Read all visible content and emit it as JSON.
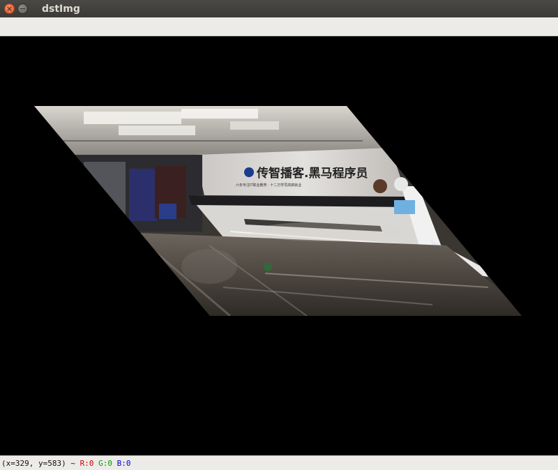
{
  "window": {
    "title": "dstImg",
    "close_glyph": "×",
    "minimize_glyph": "−"
  },
  "status": {
    "coords": "(x=329, y=583) ~",
    "r": "R:0",
    "g": "G:0",
    "b": "B:0"
  },
  "image": {
    "sign_main": "传智播客.黑马程序员",
    "sign_sub": "六年专注IT职业教育 · 十二万学员高薪就业"
  }
}
